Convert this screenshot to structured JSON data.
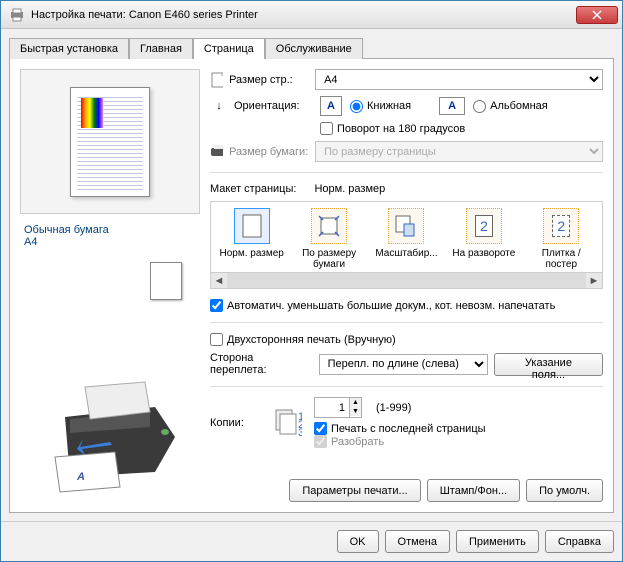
{
  "window": {
    "title": "Настройка печати: Canon E460 series Printer"
  },
  "tabs": {
    "quick": "Быстрая установка",
    "main": "Главная",
    "page": "Страница",
    "service": "Обслуживание"
  },
  "paper_info": {
    "type": "Обычная бумага",
    "size": "A4"
  },
  "page_size": {
    "label": "Размер стр.:",
    "value": "A4"
  },
  "orientation": {
    "label": "Ориентация:",
    "portrait": "Книжная",
    "landscape": "Альбомная",
    "rotate": "Поворот на 180 градусов"
  },
  "printer_paper": {
    "label": "Размер бумаги:",
    "value": "По размеру страницы"
  },
  "layout": {
    "label": "Макет страницы:",
    "current": "Норм. размер",
    "items": [
      "Норм. размер",
      "По размеру бумаги",
      "Масштабир...",
      "На развороте",
      "Плитка / постер"
    ]
  },
  "autoshrink": "Автоматич. уменьшать большие докум., кот. невозм. напечатать",
  "duplex": {
    "label": "Двухсторонняя печать (Вручную)",
    "side_label": "Сторона переплета:",
    "side_value": "Перепл. по длине (слева)",
    "margin_btn": "Указание поля..."
  },
  "copies": {
    "label": "Копии:",
    "value": "1",
    "range": "(1-999)",
    "from_last": "Печать с последней страницы",
    "collate": "Разобрать"
  },
  "buttons": {
    "print_options": "Параметры печати...",
    "stamp": "Штамп/Фон...",
    "defaults": "По умолч."
  },
  "dialog": {
    "ok": "OK",
    "cancel": "Отмена",
    "apply": "Применить",
    "help": "Справка"
  }
}
